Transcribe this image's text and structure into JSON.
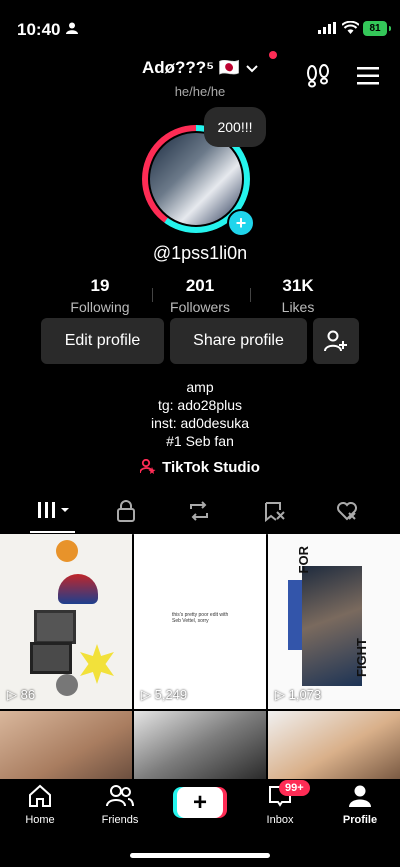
{
  "status_bar": {
    "time": "10:40",
    "battery": "81"
  },
  "header": {
    "username": "Adø???⁵ 🇯🇵",
    "subtitle": "he/he/he"
  },
  "avatar": {
    "bubble_text": "200!!!"
  },
  "profile": {
    "handle": "@1pss1li0n"
  },
  "stats": [
    {
      "value": "19",
      "label": "Following"
    },
    {
      "value": "201",
      "label": "Followers"
    },
    {
      "value": "31K",
      "label": "Likes"
    }
  ],
  "buttons": {
    "edit": "Edit profile",
    "share": "Share profile"
  },
  "bio": [
    "amp",
    "tg: ado28plus",
    "inst: ad0desuka",
    "#1 Seb fan"
  ],
  "studio_label": "TikTok Studio",
  "tabs": [
    "grid-icon",
    "lock-icon",
    "repost-icon",
    "favorites-icon",
    "liked-icon"
  ],
  "videos": [
    {
      "views": "86"
    },
    {
      "views": "5,249",
      "text": "this's pretty poor edit with Seb Vettel, sorry"
    },
    {
      "views": "1,073",
      "text_top": "FOR",
      "text_bottom": "FIGHT"
    }
  ],
  "bottom_nav": {
    "home": "Home",
    "friends": "Friends",
    "inbox": "Inbox",
    "inbox_badge": "99+",
    "profile": "Profile"
  },
  "colors": {
    "accent_cyan": "#25f4ee",
    "accent_red": "#fe2c55",
    "battery": "#34c759"
  }
}
